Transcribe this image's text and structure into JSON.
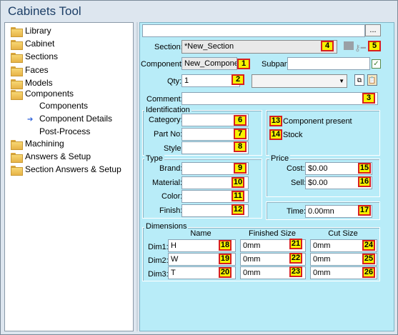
{
  "app": {
    "title": "Cabinets Tool"
  },
  "tree": {
    "items": [
      {
        "label": "Library",
        "icon": "folder-icon"
      },
      {
        "label": "Cabinet",
        "icon": "folder-icon"
      },
      {
        "label": "Sections",
        "icon": "folder-icon"
      },
      {
        "label": "Faces",
        "icon": "folder-icon"
      },
      {
        "label": "Models",
        "icon": "folder-icon"
      },
      {
        "label": "Components",
        "icon": "folder-open-icon"
      },
      {
        "label": "Components",
        "icon": "none"
      },
      {
        "label": "Component Details",
        "icon": "arrow-right-icon",
        "selected": true
      },
      {
        "label": "Post-Process",
        "icon": "none"
      },
      {
        "label": "Machining",
        "icon": "folder-icon"
      },
      {
        "label": "Answers & Setup",
        "icon": "folder-icon"
      },
      {
        "label": "Section Answers & Setup",
        "icon": "folder-icon"
      }
    ]
  },
  "form": {
    "top_input_value": "",
    "browse_label": "...",
    "section_label": "Section:",
    "section_value": "*New_Section",
    "component_label": "Component:",
    "component_value": "New_Compone",
    "subpart_label": "Subpart",
    "subpart_value": "",
    "qty_label": "Qty:",
    "qty_value": "1",
    "comment_label": "Comment:",
    "comment_value": "",
    "identification_title": "Identification",
    "category_label": "Category:",
    "partno_label": "Part No:",
    "style_label": "Style:",
    "component_present_label": "Component present",
    "stock_label": "Stock",
    "type_title": "Type",
    "brand_label": "Brand:",
    "material_label": "Material:",
    "color_label": "Color:",
    "finish_label": "Finish:",
    "price_title": "Price",
    "cost_label": "Cost:",
    "cost_value": "$0.00",
    "sell_label": "Sell:",
    "sell_value": "$0.00",
    "time_label": "Time:",
    "time_value": "0.00mn",
    "dimensions_title": "Dimensions",
    "col_name": "Name",
    "col_finished": "Finished Size",
    "col_cut": "Cut Size",
    "dims": [
      {
        "label": "Dim1:",
        "name": "H",
        "finished": "0mm",
        "cut": "0mm"
      },
      {
        "label": "Dim2:",
        "name": "W",
        "finished": "0mm",
        "cut": "0mm"
      },
      {
        "label": "Dim3:",
        "name": "T",
        "finished": "0mm",
        "cut": "0mm"
      }
    ]
  },
  "badges": [
    "1",
    "2",
    "3",
    "4",
    "5",
    "6",
    "7",
    "8",
    "9",
    "10",
    "11",
    "12",
    "13",
    "14",
    "15",
    "16",
    "17",
    "18",
    "19",
    "20",
    "21",
    "22",
    "23",
    "24",
    "25",
    "26"
  ],
  "colors": {
    "badge_fill": "#f7f200",
    "badge_border": "#d81f1f",
    "form_bg": "#b8ecf8",
    "title_text": "#1c3e66"
  }
}
